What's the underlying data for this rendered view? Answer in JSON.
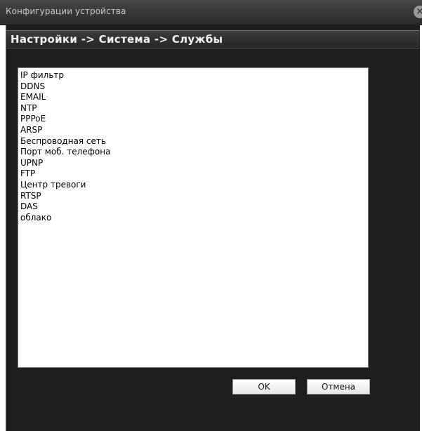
{
  "window": {
    "title": "Конфигурации устройства"
  },
  "breadcrumb": "Настройки -> Система -> Службы",
  "services": [
    "IP фильтр",
    "DDNS",
    "EMAIL",
    "NTP",
    "PPPoE",
    "ARSP",
    "Беспроводная сеть",
    "Порт моб. телефона",
    "UPNP",
    "FTP",
    "Центр тревоги",
    "RTSP",
    "DAS",
    "облако"
  ],
  "buttons": {
    "ok": "OK",
    "cancel": "Отмена"
  },
  "colors": {
    "titlebar": "#3a3a3a",
    "body": "#1e1e1e",
    "list_background": "#ffffff"
  },
  "icons": {
    "close": "close-icon"
  }
}
